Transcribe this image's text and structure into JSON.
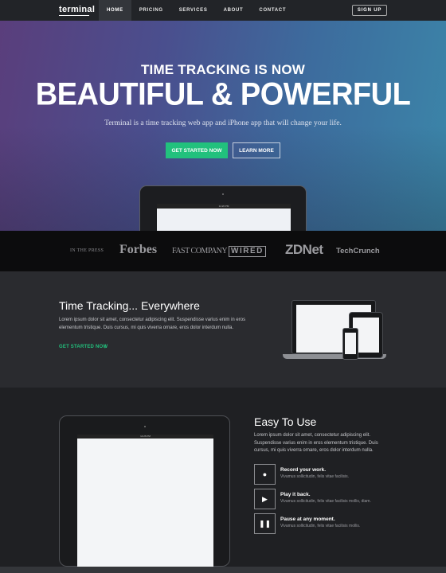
{
  "nav": {
    "brand": "terminal",
    "links": [
      "HOME",
      "PRICING",
      "SERVICES",
      "ABOUT",
      "CONTACT"
    ],
    "active": "HOME",
    "signup": "SIGN UP"
  },
  "hero": {
    "subtitle": "TIME TRACKING IS NOW",
    "title": "BEAUTIFUL & POWERFUL",
    "description": "Terminal is a time tracking web app and iPhone app that will change your life.",
    "primary_button": "GET STARTED NOW",
    "secondary_button": "LEARN MORE",
    "device_time": "14:26 PM"
  },
  "press": {
    "label": "IN THE PRESS",
    "logos": [
      "Forbes",
      "FAST COMPANY",
      "WIRED",
      "ZDNet",
      "TechCrunch"
    ]
  },
  "section_everywhere": {
    "title": "Time Tracking... Everywhere",
    "text": "Lorem ipsum dolor sit amet, consectetur adipiscing elit. Suspendisse varius enim in eros elementum tristique. Duis cursus, mi quis viverra ornare, eros dolor interdum nulla.",
    "link": "GET STARTED NOW"
  },
  "section_easy": {
    "title": "Easy To Use",
    "text": "Lorem ipsum dolor sit amet, consectetur adipiscing elit. Suspendisse varius enim in eros elementum tristique. Duis cursus, mi quis viverra ornare, eros dolor interdum nulla.",
    "device_time": "14:26 PM",
    "features": [
      {
        "icon": "record-icon",
        "title": "Record your work.",
        "desc": "Vivamus sollicitudin, felis vitae facilisis."
      },
      {
        "icon": "play-icon",
        "title": "Play it back.",
        "desc": "Vivamus sollicitudin, felis vitae facilisis mollis, diam."
      },
      {
        "icon": "pause-icon",
        "title": "Pause at any moment.",
        "desc": "Vivamus sollicitudin, felis vitae facilisis mollis."
      }
    ]
  },
  "colors": {
    "accent_green": "#22c17d",
    "nav_bg": "#222428",
    "press_bg": "#0c0c0d"
  }
}
